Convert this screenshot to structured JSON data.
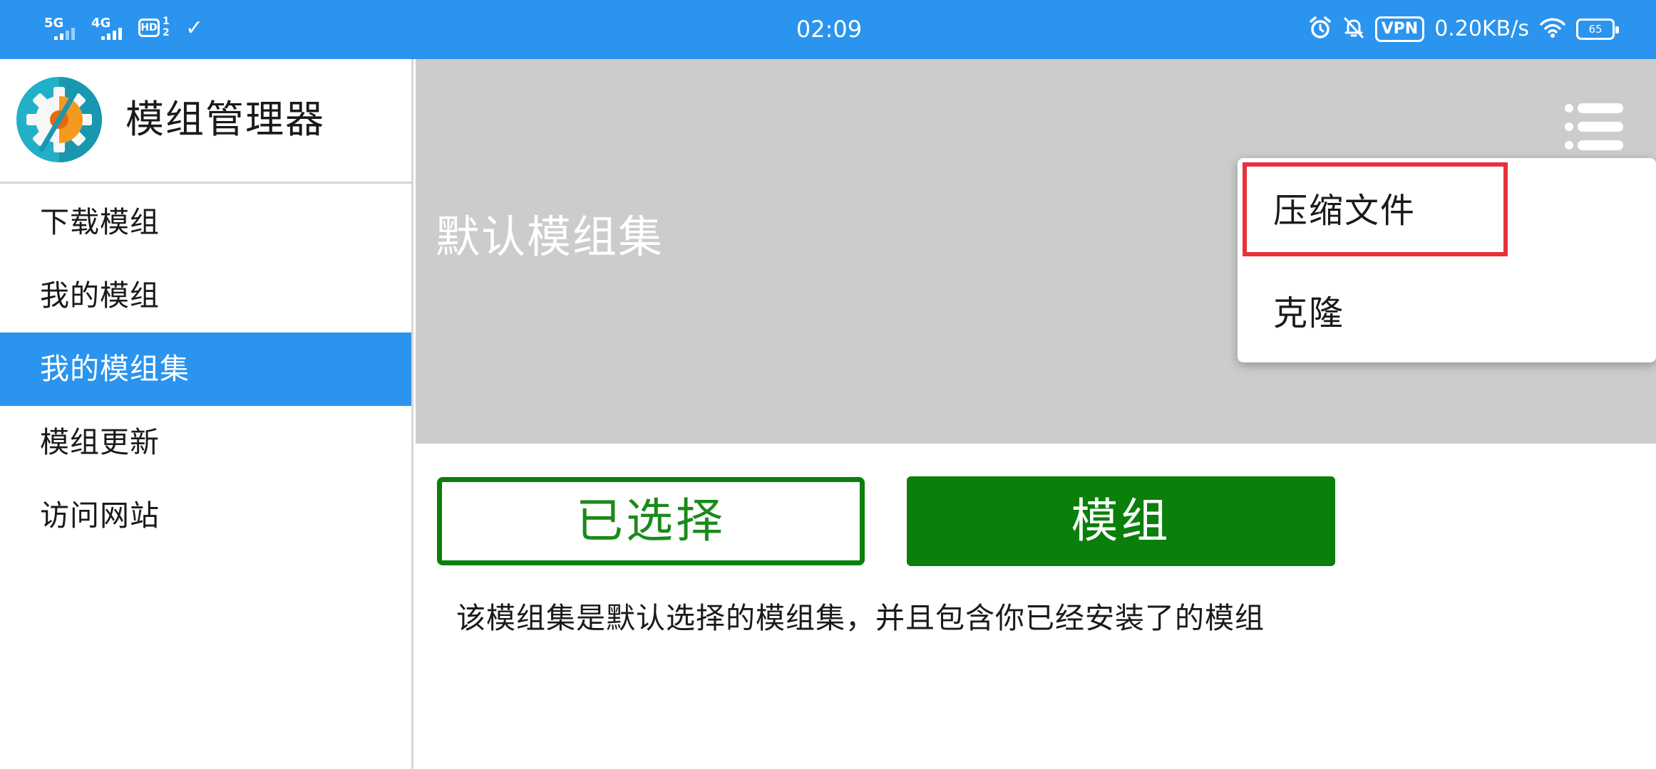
{
  "status_bar": {
    "signal_1": "5G",
    "signal_2": "4G",
    "hd_label": "HD",
    "hd_sim": "1",
    "hd_sim_sub": "2",
    "time": "02:09",
    "vpn": "VPN",
    "speed": "0.20KB/s",
    "battery": "65"
  },
  "app": {
    "title": "模组管理器"
  },
  "sidebar": {
    "items": [
      {
        "label": "下载模组"
      },
      {
        "label": "我的模组"
      },
      {
        "label": "我的模组集"
      },
      {
        "label": "模组更新"
      },
      {
        "label": "访问网站"
      }
    ],
    "active_index": 2
  },
  "main": {
    "banner_title": "默认模组集",
    "selected_button": "已选择",
    "mods_button": "模组",
    "description": "该模组集是默认选择的模组集，并且包含你已经安装了的模组"
  },
  "menu": {
    "items": [
      {
        "label": "压缩文件"
      },
      {
        "label": "克隆"
      }
    ]
  },
  "colors": {
    "accent": "#2a94ee",
    "green": "#0a7f0a",
    "banner_gray": "#cccccc",
    "highlight_red": "#e8313a"
  },
  "icons": {
    "app_logo": "gear-logo-icon",
    "menu": "list-menu-icon"
  }
}
